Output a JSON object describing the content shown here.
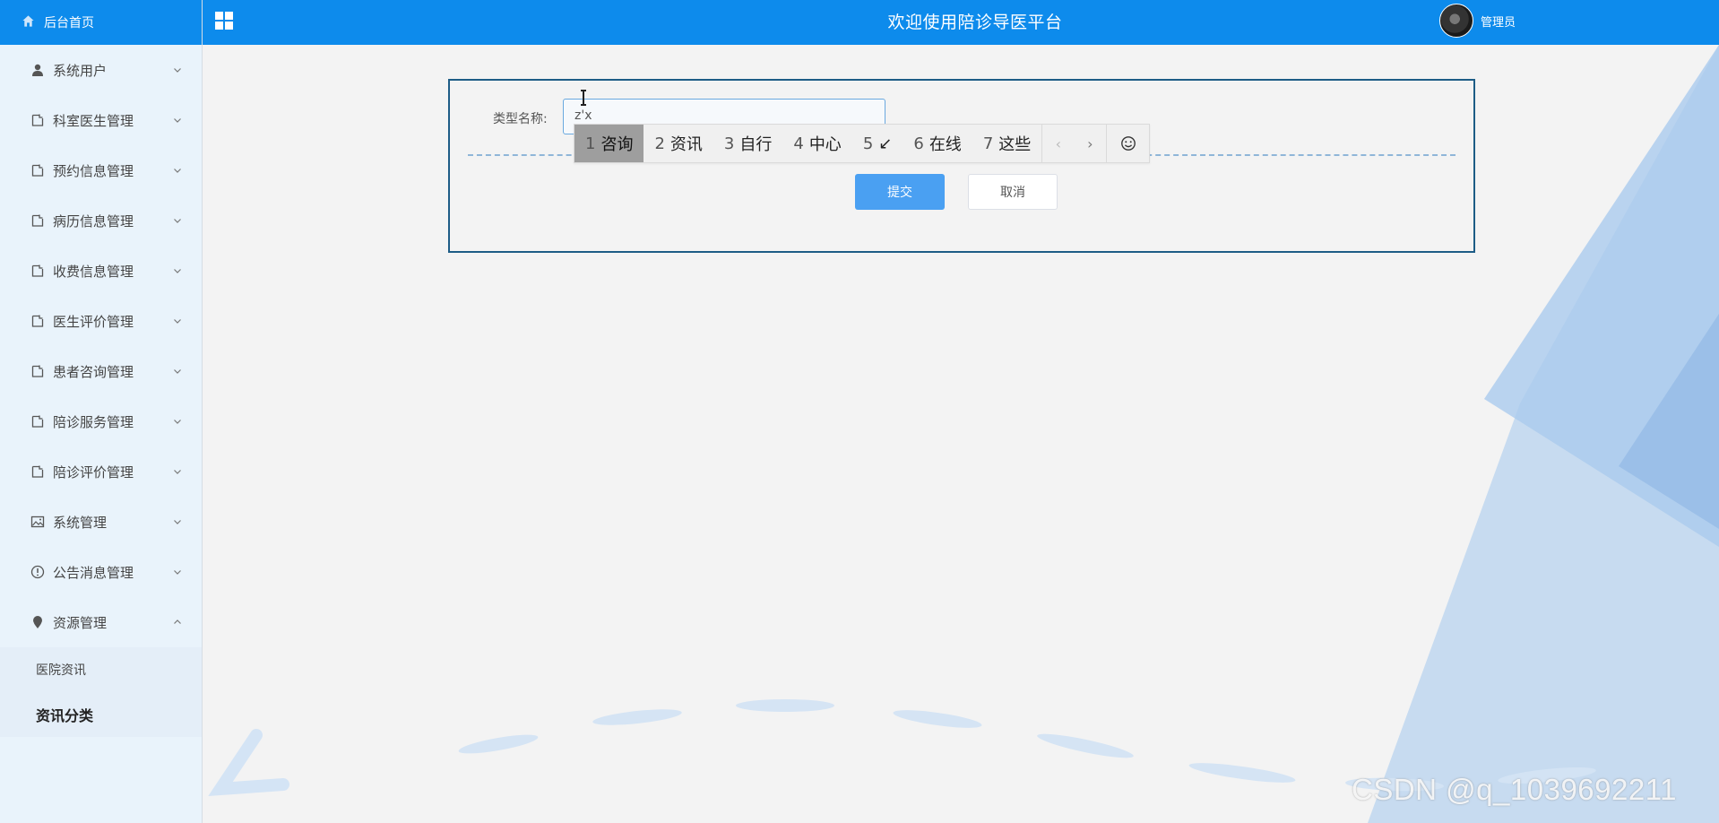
{
  "header": {
    "title": "欢迎使用陪诊导医平台",
    "user_name": "管理员",
    "brand_color": "#0d8bec"
  },
  "sidebar": {
    "home_label": "后台首页",
    "items": [
      {
        "label": "系统用户",
        "icon": "user-icon"
      },
      {
        "label": "科室医生管理",
        "icon": "doc-icon"
      },
      {
        "label": "预约信息管理",
        "icon": "doc-icon"
      },
      {
        "label": "病历信息管理",
        "icon": "doc-icon"
      },
      {
        "label": "收费信息管理",
        "icon": "doc-icon"
      },
      {
        "label": "医生评价管理",
        "icon": "doc-icon"
      },
      {
        "label": "患者咨询管理",
        "icon": "doc-icon"
      },
      {
        "label": "陪诊服务管理",
        "icon": "doc-icon"
      },
      {
        "label": "陪诊评价管理",
        "icon": "doc-icon"
      },
      {
        "label": "系统管理",
        "icon": "picture-icon"
      },
      {
        "label": "公告消息管理",
        "icon": "info-icon"
      },
      {
        "label": "资源管理",
        "icon": "location-icon",
        "expanded": true
      }
    ],
    "sub_items": [
      {
        "label": "医院资讯",
        "active": false
      },
      {
        "label": "资讯分类",
        "active": true
      }
    ]
  },
  "form": {
    "type_name_label": "类型名称:",
    "type_name_value": "z'x",
    "submit_label": "提交",
    "cancel_label": "取消"
  },
  "ime": {
    "candidates": [
      {
        "num": "1",
        "text": "咨询",
        "selected": true
      },
      {
        "num": "2",
        "text": "资讯",
        "selected": false
      },
      {
        "num": "3",
        "text": "自行",
        "selected": false
      },
      {
        "num": "4",
        "text": "中心",
        "selected": false
      },
      {
        "num": "5",
        "text": "↙",
        "selected": false
      },
      {
        "num": "6",
        "text": "在线",
        "selected": false
      },
      {
        "num": "7",
        "text": "这些",
        "selected": false
      }
    ],
    "prev": "‹",
    "next": "›"
  },
  "watermark": "CSDN @q_1039692211"
}
